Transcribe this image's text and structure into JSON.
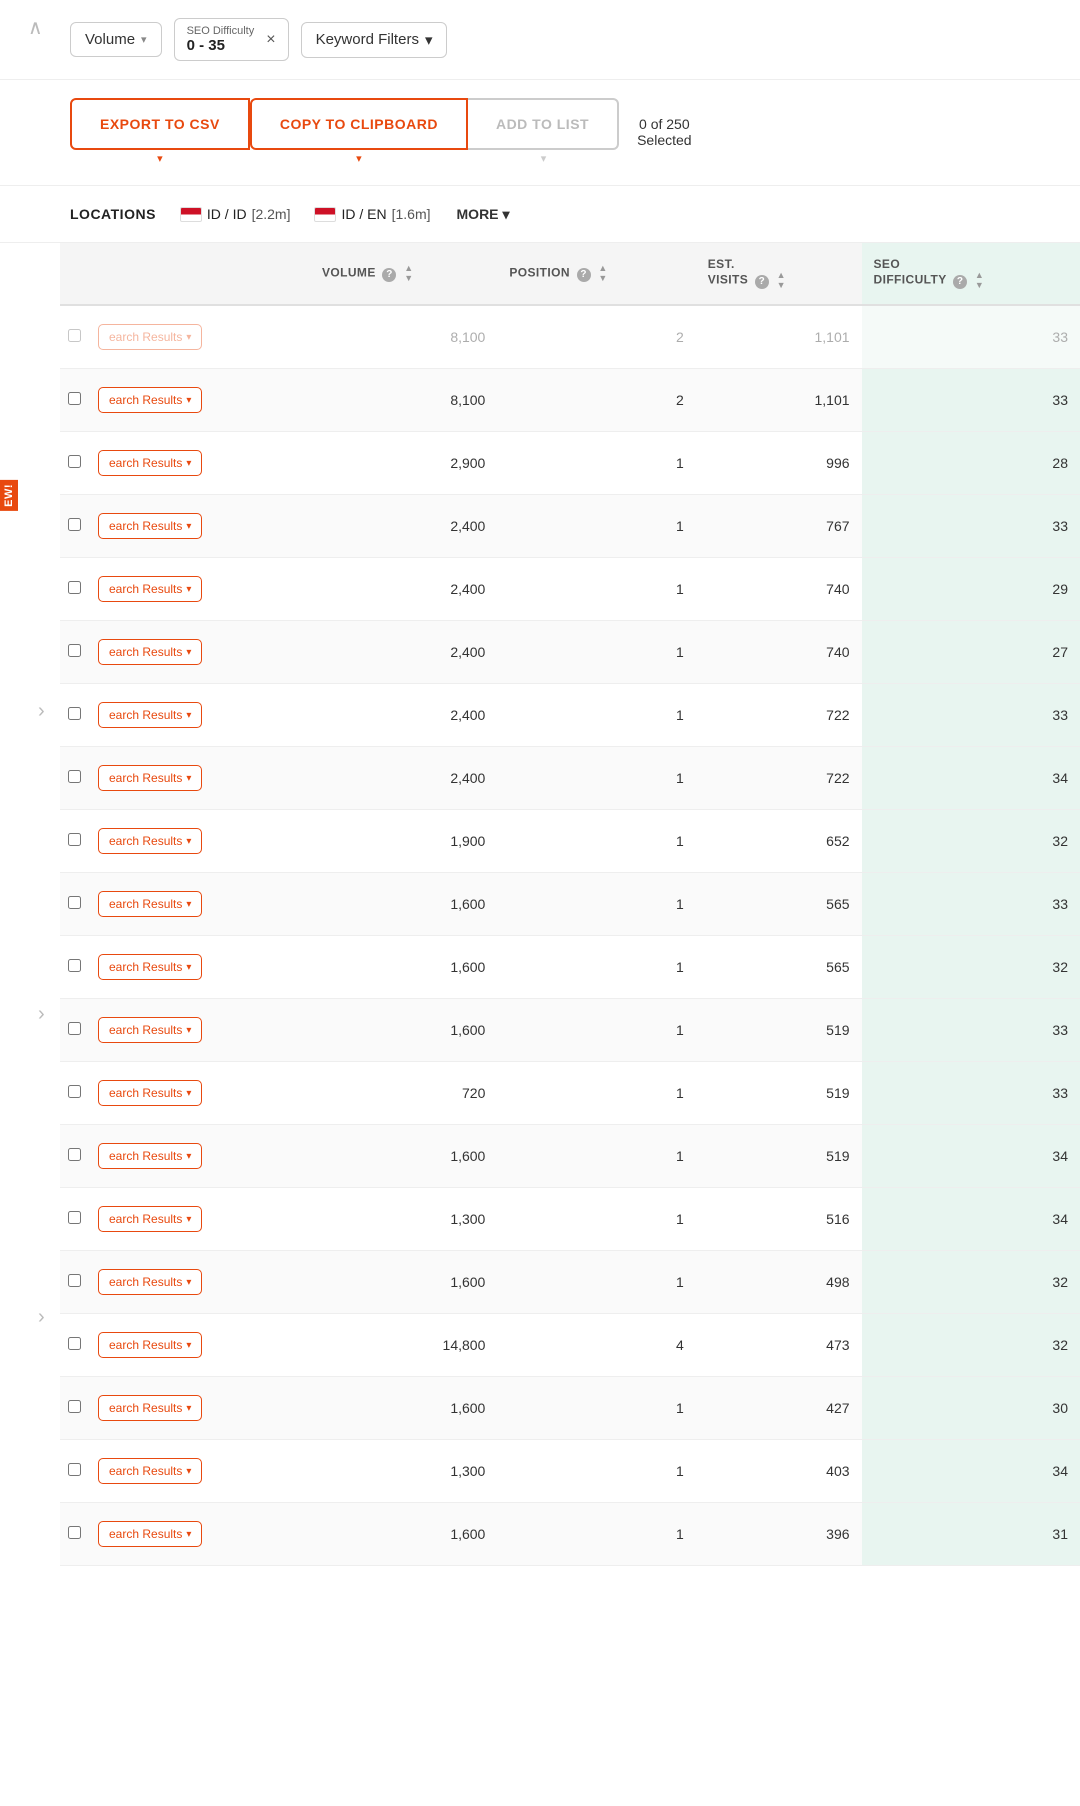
{
  "topbar": {
    "volume_label": "Volume",
    "seo_filter": {
      "label": "SEO Difficulty",
      "value": "0 - 35",
      "close": "×"
    },
    "keyword_filters_label": "Keyword Filters",
    "keyword_filters_arrow": "▾"
  },
  "actionbar": {
    "export_label": "EXPORT TO CSV",
    "copy_label": "COPY TO CLIPBOARD",
    "add_label": "ADD TO LIST",
    "selected_text": "0 of 250",
    "selected_label": "Selected"
  },
  "locations": {
    "label": "LOCATIONS",
    "items": [
      {
        "code": "ID / ID",
        "value": "[2.2m]"
      },
      {
        "code": "ID / EN",
        "value": "[1.6m]"
      }
    ],
    "more_label": "MORE"
  },
  "table": {
    "headers": [
      {
        "label": "",
        "key": "checkbox"
      },
      {
        "label": "",
        "key": "keyword"
      },
      {
        "label": "VOLUME",
        "key": "volume",
        "help": true,
        "sort": true
      },
      {
        "label": "POSITION",
        "key": "position",
        "help": true,
        "sort": true
      },
      {
        "label": "EST. VISITS",
        "key": "est_visits",
        "help": true,
        "sort": true
      },
      {
        "label": "SEO DIFFICULTY",
        "key": "seo_difficulty",
        "help": true,
        "sort": true
      }
    ],
    "rows": [
      {
        "keyword": "earch Results",
        "volume": "8,100",
        "position": "2",
        "est_visits": "1,101",
        "seo_difficulty": "33",
        "top_partial": true
      },
      {
        "keyword": "earch Results",
        "volume": "8,100",
        "position": "2",
        "est_visits": "1,101",
        "seo_difficulty": "33"
      },
      {
        "keyword": "earch Results",
        "volume": "2,900",
        "position": "1",
        "est_visits": "996",
        "seo_difficulty": "28"
      },
      {
        "keyword": "earch Results",
        "volume": "2,400",
        "position": "1",
        "est_visits": "767",
        "seo_difficulty": "33"
      },
      {
        "keyword": "earch Results",
        "volume": "2,400",
        "position": "1",
        "est_visits": "740",
        "seo_difficulty": "29"
      },
      {
        "keyword": "earch Results",
        "volume": "2,400",
        "position": "1",
        "est_visits": "740",
        "seo_difficulty": "27"
      },
      {
        "keyword": "earch Results",
        "volume": "2,400",
        "position": "1",
        "est_visits": "722",
        "seo_difficulty": "33"
      },
      {
        "keyword": "earch Results",
        "volume": "2,400",
        "position": "1",
        "est_visits": "722",
        "seo_difficulty": "34"
      },
      {
        "keyword": "earch Results",
        "volume": "1,900",
        "position": "1",
        "est_visits": "652",
        "seo_difficulty": "32"
      },
      {
        "keyword": "earch Results",
        "volume": "1,600",
        "position": "1",
        "est_visits": "565",
        "seo_difficulty": "33"
      },
      {
        "keyword": "earch Results",
        "volume": "1,600",
        "position": "1",
        "est_visits": "565",
        "seo_difficulty": "32"
      },
      {
        "keyword": "earch Results",
        "volume": "1,600",
        "position": "1",
        "est_visits": "519",
        "seo_difficulty": "33"
      },
      {
        "keyword": "earch Results",
        "volume": "720",
        "position": "1",
        "est_visits": "519",
        "seo_difficulty": "33"
      },
      {
        "keyword": "earch Results",
        "volume": "1,600",
        "position": "1",
        "est_visits": "519",
        "seo_difficulty": "34"
      },
      {
        "keyword": "earch Results",
        "volume": "1,300",
        "position": "1",
        "est_visits": "516",
        "seo_difficulty": "34"
      },
      {
        "keyword": "earch Results",
        "volume": "1,600",
        "position": "1",
        "est_visits": "498",
        "seo_difficulty": "32"
      },
      {
        "keyword": "earch Results",
        "volume": "14,800",
        "position": "4",
        "est_visits": "473",
        "seo_difficulty": "32"
      },
      {
        "keyword": "earch Results",
        "volume": "1,600",
        "position": "1",
        "est_visits": "427",
        "seo_difficulty": "30"
      },
      {
        "keyword": "earch Results",
        "volume": "1,300",
        "position": "1",
        "est_visits": "403",
        "seo_difficulty": "34"
      },
      {
        "keyword": "earch Results",
        "volume": "1,600",
        "position": "1",
        "est_visits": "396",
        "seo_difficulty": "31"
      }
    ]
  },
  "sidebar": {
    "new_badge": "EW!",
    "expand_arrows": [
      "›",
      "›",
      "›"
    ]
  }
}
